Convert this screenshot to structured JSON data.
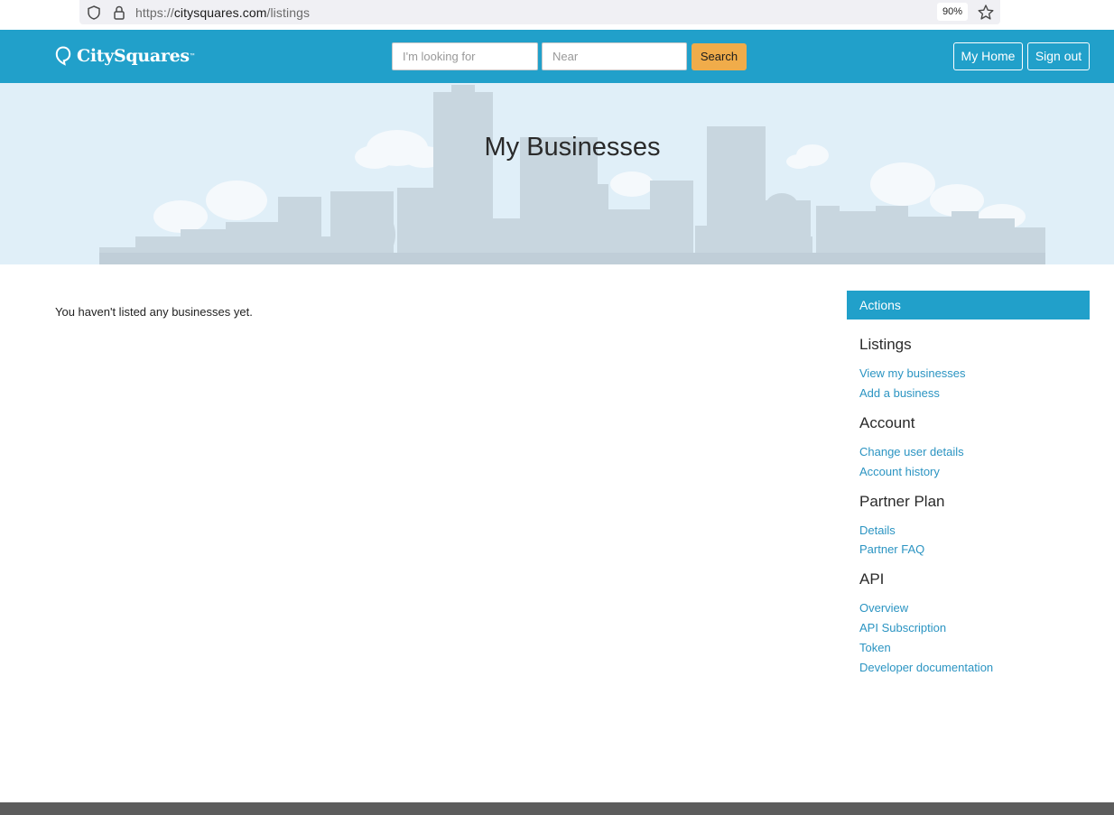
{
  "browser": {
    "url_scheme": "https://",
    "url_host": "citysquares.com",
    "url_path": "/listings",
    "zoom": "90%"
  },
  "header": {
    "logo_text": "CitySquares",
    "logo_tm": "™",
    "search_placeholder": "I'm looking for",
    "near_placeholder": "Near",
    "search_label": "Search",
    "my_home_label": "My Home",
    "sign_out_label": "Sign out"
  },
  "hero": {
    "title": "My Businesses"
  },
  "main": {
    "empty_message": "You haven't listed any businesses yet."
  },
  "sidebar": {
    "actions_label": "Actions",
    "sections": [
      {
        "heading": "Listings",
        "links": [
          "View my businesses",
          "Add a business"
        ]
      },
      {
        "heading": "Account",
        "links": [
          "Change user details",
          "Account history"
        ]
      },
      {
        "heading": "Partner Plan",
        "links": [
          "Details",
          "Partner FAQ"
        ]
      },
      {
        "heading": "API",
        "links": [
          "Overview",
          "API Subscription",
          "Token",
          "Developer documentation"
        ]
      }
    ]
  },
  "colors": {
    "brand_blue": "#21a0ca",
    "search_orange": "#f0ac4a",
    "link_blue": "#2b94c2",
    "hero_bg": "#e0eff8",
    "footer_gray": "#5c5c5c"
  }
}
